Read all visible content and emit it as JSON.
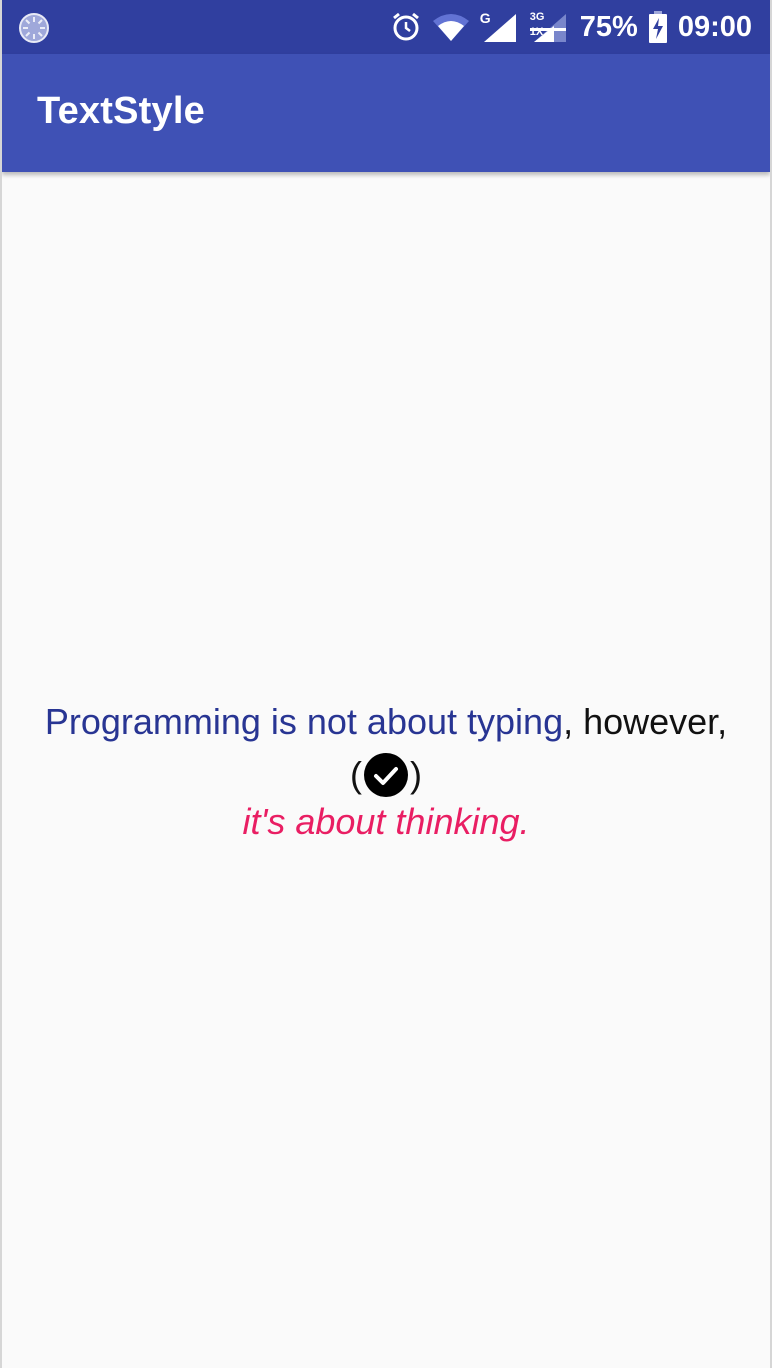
{
  "status_bar": {
    "network_label": "G",
    "network_sub_label": "3G",
    "network_sub_label2": "1X",
    "battery_percent": "75%",
    "time": "09:00",
    "icons": [
      "loading-spinner-icon",
      "alarm-icon",
      "wifi-icon",
      "signal-icon",
      "signal-3g-icon",
      "battery-charging-icon"
    ]
  },
  "app_bar": {
    "title": "TextStyle"
  },
  "content": {
    "line1_blue": "Programming is not about typing",
    "line1_black": ", however,",
    "paren_open": "(",
    "paren_close": ")",
    "check_icon": "check-circle-icon",
    "line3_pink": "it's about thinking."
  },
  "colors": {
    "status_bar": "#303f9f",
    "app_bar": "#3f51b5",
    "background": "#fafafa",
    "blue_text": "#283593",
    "pink_text": "#e91e63"
  }
}
